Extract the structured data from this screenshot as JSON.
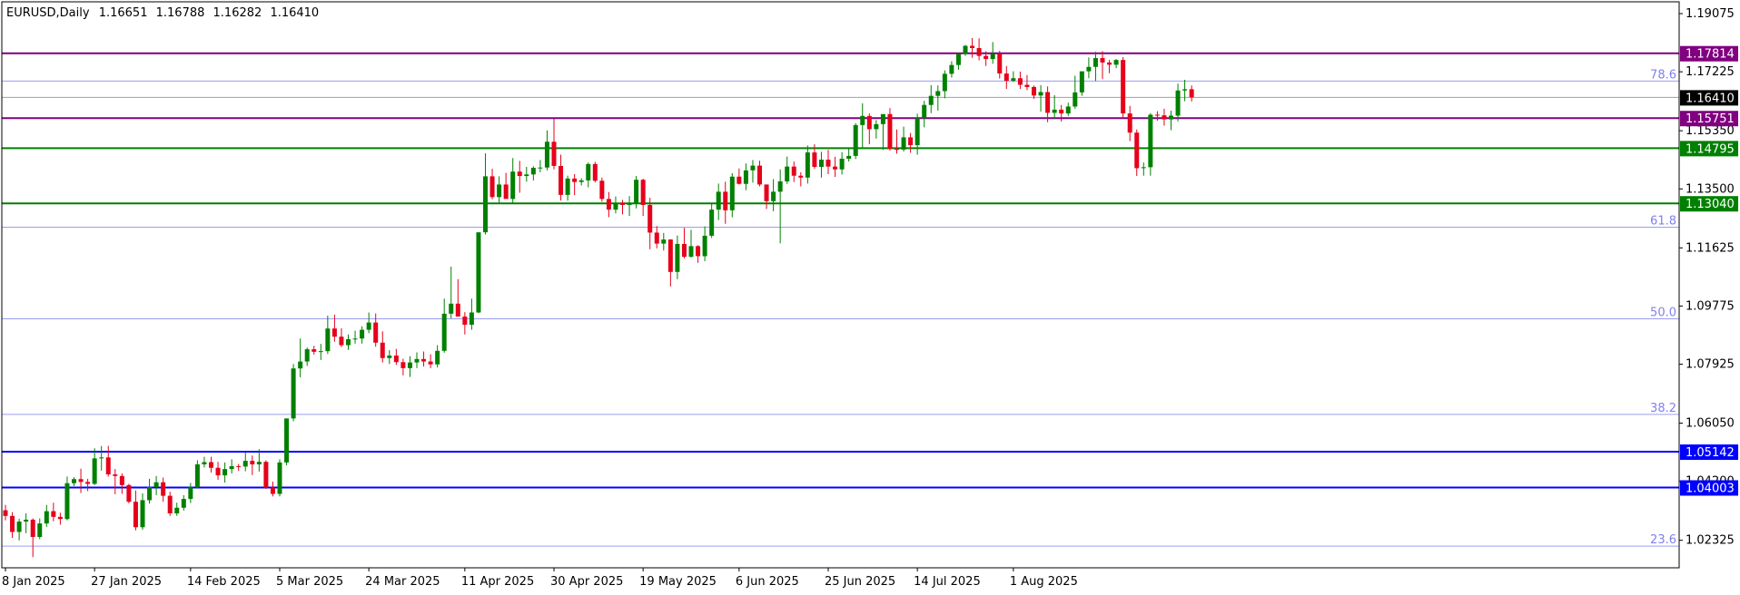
{
  "header": {
    "symbol": "EURUSD,Daily",
    "open": "1.16651",
    "high": "1.16788",
    "low": "1.16282",
    "close": "1.16410"
  },
  "colors": {
    "background": "#ffffff",
    "frame": "#000000",
    "bull": "#008000",
    "bear": "#e6001a",
    "fib": "#9c9cf2",
    "fib_text": "#8080ee",
    "resistance": "#800080",
    "support_mid": "#008000",
    "support_low": "#0000ff",
    "price_line": "#a0a0a0",
    "current_label_bg": "#000000"
  },
  "chart_data": {
    "type": "candlestick",
    "symbol": "EURUSD",
    "timeframe": "Daily",
    "ylim": [
      1.0145,
      1.1945
    ],
    "yticks": [
      "1.19075",
      "1.17225",
      "1.15350",
      "1.13500",
      "1.11625",
      "1.09775",
      "1.07925",
      "1.06050",
      "1.04200",
      "1.02325"
    ],
    "ytick_values": [
      1.19075,
      1.17225,
      1.1535,
      1.135,
      1.11625,
      1.09775,
      1.07925,
      1.0605,
      1.042,
      1.02325
    ],
    "xticks": [
      {
        "label": "8 Jan 2025",
        "index": 0
      },
      {
        "label": "27 Jan 2025",
        "index": 13
      },
      {
        "label": "14 Feb 2025",
        "index": 27
      },
      {
        "label": "5 Mar 2025",
        "index": 40
      },
      {
        "label": "24 Mar 2025",
        "index": 53
      },
      {
        "label": "11 Apr 2025",
        "index": 67
      },
      {
        "label": "30 Apr 2025",
        "index": 80
      },
      {
        "label": "19 May 2025",
        "index": 93
      },
      {
        "label": "6 Jun 2025",
        "index": 107
      },
      {
        "label": "25 Jun 2025",
        "index": 120
      },
      {
        "label": "14 Jul 2025",
        "index": 133
      },
      {
        "label": "1 Aug 2025",
        "index": 147
      }
    ],
    "horizontal_levels": [
      {
        "label": "1.17814",
        "value": 1.17814,
        "color": "#800080"
      },
      {
        "label": "1.15751",
        "value": 1.15751,
        "color": "#800080"
      },
      {
        "label": "1.14795",
        "value": 1.14795,
        "color": "#008000"
      },
      {
        "label": "1.13040",
        "value": 1.1304,
        "color": "#008000"
      },
      {
        "label": "1.05142",
        "value": 1.05142,
        "color": "#0000ff"
      },
      {
        "label": "1.04003",
        "value": 1.04003,
        "color": "#0000ff"
      }
    ],
    "current_price": {
      "label": "1.16410",
      "value": 1.1641
    },
    "fibonacci": [
      {
        "label": "78.6",
        "value": 1.1693
      },
      {
        "label": "61.8",
        "value": 1.1228
      },
      {
        "label": "50.0",
        "value": 1.0937
      },
      {
        "label": "38.2",
        "value": 1.0633
      },
      {
        "label": "23.6",
        "value": 1.0214
      }
    ],
    "candles": [
      [
        1.0328,
        1.0345,
        1.0296,
        1.031
      ],
      [
        1.031,
        1.0322,
        1.024,
        1.0259
      ],
      [
        1.0259,
        1.0301,
        1.0232,
        1.0292
      ],
      [
        1.0292,
        1.0318,
        1.0255,
        1.0298
      ],
      [
        1.0298,
        1.0302,
        1.0179,
        1.0243
      ],
      [
        1.0243,
        1.0302,
        1.0236,
        1.0286
      ],
      [
        1.0286,
        1.0345,
        1.0275,
        1.0325
      ],
      [
        1.0325,
        1.0352,
        1.0293,
        1.0307
      ],
      [
        1.0307,
        1.032,
        1.0282,
        1.03
      ],
      [
        1.03,
        1.0435,
        1.0296,
        1.0414
      ],
      [
        1.0414,
        1.0433,
        1.0405,
        1.0427
      ],
      [
        1.0427,
        1.046,
        1.0383,
        1.0418
      ],
      [
        1.0418,
        1.0428,
        1.0389,
        1.0412
      ],
      [
        1.0412,
        1.0525,
        1.0408,
        1.0493
      ],
      [
        1.0493,
        1.0532,
        1.0454,
        1.0496
      ],
      [
        1.0496,
        1.0533,
        1.0435,
        1.0442
      ],
      [
        1.0442,
        1.0459,
        1.0379,
        1.0437
      ],
      [
        1.0437,
        1.0445,
        1.038,
        1.0408
      ],
      [
        1.0408,
        1.0412,
        1.035,
        1.0355
      ],
      [
        1.0355,
        1.0391,
        1.0264,
        1.0274
      ],
      [
        1.0274,
        1.0382,
        1.0266,
        1.036
      ],
      [
        1.036,
        1.0428,
        1.0349,
        1.0402
      ],
      [
        1.0402,
        1.0437,
        1.0376,
        1.0417
      ],
      [
        1.0417,
        1.0432,
        1.0355,
        1.0374
      ],
      [
        1.0374,
        1.0387,
        1.031,
        1.0318
      ],
      [
        1.0318,
        1.0352,
        1.031,
        1.0336
      ],
      [
        1.0336,
        1.0376,
        1.0327,
        1.0364
      ],
      [
        1.0364,
        1.0415,
        1.0351,
        1.0401
      ],
      [
        1.0401,
        1.0487,
        1.0397,
        1.0474
      ],
      [
        1.0474,
        1.0498,
        1.0464,
        1.0481
      ],
      [
        1.0481,
        1.0498,
        1.0448,
        1.0463
      ],
      [
        1.0463,
        1.0482,
        1.0425,
        1.0439
      ],
      [
        1.0439,
        1.048,
        1.0416,
        1.0459
      ],
      [
        1.0459,
        1.049,
        1.0445,
        1.0468
      ],
      [
        1.0468,
        1.0475,
        1.0453,
        1.0467
      ],
      [
        1.0467,
        1.0513,
        1.0452,
        1.0485
      ],
      [
        1.0485,
        1.0502,
        1.044,
        1.0474
      ],
      [
        1.0474,
        1.0522,
        1.0451,
        1.0482
      ],
      [
        1.0482,
        1.0487,
        1.0396,
        1.04
      ],
      [
        1.04,
        1.0419,
        1.0372,
        1.038
      ],
      [
        1.038,
        1.049,
        1.0372,
        1.048
      ],
      [
        1.048,
        1.0591,
        1.0471,
        1.062
      ],
      [
        1.062,
        1.0793,
        1.0611,
        1.0779
      ],
      [
        1.0779,
        1.0874,
        1.0751,
        1.0801
      ],
      [
        1.0801,
        1.0846,
        1.0787,
        1.084
      ],
      [
        1.084,
        1.0851,
        1.0823,
        1.0832
      ],
      [
        1.0832,
        1.0857,
        1.0806,
        1.0834
      ],
      [
        1.0834,
        1.0947,
        1.0825,
        1.0906
      ],
      [
        1.0906,
        1.095,
        1.0864,
        1.088
      ],
      [
        1.088,
        1.0907,
        1.0847,
        1.0853
      ],
      [
        1.0853,
        1.0887,
        1.0838,
        1.0872
      ],
      [
        1.0872,
        1.0899,
        1.0858,
        1.0874
      ],
      [
        1.0874,
        1.0913,
        1.0858,
        1.0902
      ],
      [
        1.0902,
        1.0957,
        1.0891,
        1.0925
      ],
      [
        1.0925,
        1.0954,
        1.0848,
        1.0861
      ],
      [
        1.0861,
        1.0897,
        1.0798,
        1.0812
      ],
      [
        1.0812,
        1.0837,
        1.0793,
        1.082
      ],
      [
        1.082,
        1.0841,
        1.079,
        1.0799
      ],
      [
        1.0799,
        1.081,
        1.0757,
        1.078
      ],
      [
        1.078,
        1.0818,
        1.0752,
        1.0798
      ],
      [
        1.0798,
        1.083,
        1.078,
        1.0809
      ],
      [
        1.0809,
        1.0833,
        1.0785,
        1.0801
      ],
      [
        1.0801,
        1.0824,
        1.078,
        1.0792
      ],
      [
        1.0792,
        1.0853,
        1.0782,
        1.0835
      ],
      [
        1.0835,
        1.1001,
        1.0829,
        1.0953
      ],
      [
        1.0953,
        1.1103,
        1.0938,
        1.0985
      ],
      [
        1.0985,
        1.1063,
        1.0964,
        1.0944
      ],
      [
        1.0944,
        1.0958,
        1.0887,
        1.0918
      ],
      [
        1.0918,
        1.1001,
        1.0902,
        1.0957
      ],
      [
        1.0957,
        1.1144,
        1.0955,
        1.1212
      ],
      [
        1.1212,
        1.1463,
        1.1205,
        1.139
      ],
      [
        1.139,
        1.1414,
        1.1317,
        1.1324
      ],
      [
        1.1324,
        1.139,
        1.1306,
        1.1364
      ],
      [
        1.1364,
        1.1401,
        1.1327,
        1.1318
      ],
      [
        1.1318,
        1.1448,
        1.1302,
        1.1405
      ],
      [
        1.1405,
        1.1439,
        1.1338,
        1.1391
      ],
      [
        1.1391,
        1.142,
        1.1373,
        1.1396
      ],
      [
        1.1396,
        1.1422,
        1.1377,
        1.1417
      ],
      [
        1.1417,
        1.1442,
        1.1403,
        1.1418
      ],
      [
        1.1418,
        1.1536,
        1.1409,
        1.15
      ],
      [
        1.15,
        1.1573,
        1.1412,
        1.1423
      ],
      [
        1.1423,
        1.1459,
        1.1313,
        1.1331
      ],
      [
        1.1331,
        1.1392,
        1.1313,
        1.1383
      ],
      [
        1.1383,
        1.1397,
        1.133,
        1.1372
      ],
      [
        1.1372,
        1.1384,
        1.1361,
        1.1377
      ],
      [
        1.1377,
        1.1434,
        1.1355,
        1.1429
      ],
      [
        1.1429,
        1.1436,
        1.1371,
        1.1376
      ],
      [
        1.1376,
        1.1386,
        1.1309,
        1.1318
      ],
      [
        1.1318,
        1.134,
        1.126,
        1.1284
      ],
      [
        1.1284,
        1.1326,
        1.1272,
        1.1306
      ],
      [
        1.1306,
        1.1315,
        1.1269,
        1.1299
      ],
      [
        1.1299,
        1.1327,
        1.1264,
        1.1306
      ],
      [
        1.1306,
        1.1391,
        1.1288,
        1.1379
      ],
      [
        1.1379,
        1.1382,
        1.1264,
        1.1299
      ],
      [
        1.1299,
        1.1322,
        1.1158,
        1.1211
      ],
      [
        1.1211,
        1.1232,
        1.1161,
        1.1176
      ],
      [
        1.1176,
        1.121,
        1.1154,
        1.1189
      ],
      [
        1.1189,
        1.119,
        1.104,
        1.1086
      ],
      [
        1.1086,
        1.1202,
        1.1063,
        1.1175
      ],
      [
        1.1175,
        1.1226,
        1.1129,
        1.1134
      ],
      [
        1.1134,
        1.122,
        1.1132,
        1.1168
      ],
      [
        1.1168,
        1.1171,
        1.1115,
        1.1136
      ],
      [
        1.1136,
        1.1231,
        1.112,
        1.1201
      ],
      [
        1.1201,
        1.1302,
        1.1194,
        1.1284
      ],
      [
        1.1284,
        1.1367,
        1.1251,
        1.1341
      ],
      [
        1.1341,
        1.1373,
        1.1239,
        1.1282
      ],
      [
        1.1282,
        1.14,
        1.126,
        1.1389
      ],
      [
        1.1389,
        1.1415,
        1.1364,
        1.1366
      ],
      [
        1.1366,
        1.1431,
        1.1346,
        1.1409
      ],
      [
        1.1409,
        1.1442,
        1.137,
        1.1424
      ],
      [
        1.1424,
        1.144,
        1.1358,
        1.1364
      ],
      [
        1.1364,
        1.1364,
        1.1286,
        1.1311
      ],
      [
        1.1311,
        1.1381,
        1.1279,
        1.1341
      ],
      [
        1.1341,
        1.1412,
        1.1177,
        1.1374
      ],
      [
        1.1374,
        1.1453,
        1.1366,
        1.1421
      ],
      [
        1.1421,
        1.1437,
        1.1372,
        1.1392
      ],
      [
        1.1392,
        1.1403,
        1.1358,
        1.1386
      ],
      [
        1.1386,
        1.1488,
        1.1367,
        1.1466
      ],
      [
        1.1466,
        1.1492,
        1.1414,
        1.142
      ],
      [
        1.142,
        1.1468,
        1.1386,
        1.1443
      ],
      [
        1.1443,
        1.1474,
        1.1397,
        1.1421
      ],
      [
        1.1421,
        1.1452,
        1.1388,
        1.1412
      ],
      [
        1.1412,
        1.1467,
        1.1396,
        1.1446
      ],
      [
        1.1446,
        1.148,
        1.1437,
        1.1455
      ],
      [
        1.1455,
        1.1559,
        1.1445,
        1.1553
      ],
      [
        1.1553,
        1.1622,
        1.1481,
        1.1582
      ],
      [
        1.1582,
        1.159,
        1.1492,
        1.154
      ],
      [
        1.154,
        1.1569,
        1.151,
        1.1556
      ],
      [
        1.1556,
        1.1569,
        1.1474,
        1.1588
      ],
      [
        1.1588,
        1.1607,
        1.1472,
        1.1477
      ],
      [
        1.1477,
        1.1539,
        1.1462,
        1.1475
      ],
      [
        1.1475,
        1.1548,
        1.1469,
        1.1514
      ],
      [
        1.1514,
        1.1528,
        1.1465,
        1.1489
      ],
      [
        1.1489,
        1.1589,
        1.1459,
        1.1575
      ],
      [
        1.1575,
        1.163,
        1.1546,
        1.1617
      ],
      [
        1.1617,
        1.168,
        1.1591,
        1.1646
      ],
      [
        1.1646,
        1.1679,
        1.1599,
        1.1661
      ],
      [
        1.1661,
        1.1727,
        1.1638,
        1.1716
      ],
      [
        1.1716,
        1.1756,
        1.1704,
        1.1744
      ],
      [
        1.1744,
        1.1781,
        1.1729,
        1.1779
      ],
      [
        1.1779,
        1.1808,
        1.1773,
        1.1805
      ],
      [
        1.1805,
        1.183,
        1.1767,
        1.1798
      ],
      [
        1.1798,
        1.1829,
        1.1759,
        1.1773
      ],
      [
        1.1773,
        1.1788,
        1.1741,
        1.1763
      ],
      [
        1.1763,
        1.1817,
        1.1748,
        1.178
      ],
      [
        1.178,
        1.1789,
        1.1701,
        1.1717
      ],
      [
        1.1717,
        1.1741,
        1.1668,
        1.1694
      ],
      [
        1.1694,
        1.1724,
        1.169,
        1.1702
      ],
      [
        1.1702,
        1.1723,
        1.1668,
        1.1681
      ],
      [
        1.1681,
        1.1712,
        1.1664,
        1.1674
      ],
      [
        1.1674,
        1.1679,
        1.1636,
        1.1647
      ],
      [
        1.1647,
        1.168,
        1.1596,
        1.1658
      ],
      [
        1.1658,
        1.1676,
        1.1562,
        1.1592
      ],
      [
        1.1592,
        1.1648,
        1.1572,
        1.1602
      ],
      [
        1.1602,
        1.1617,
        1.1564,
        1.159
      ],
      [
        1.159,
        1.1624,
        1.1582,
        1.1612
      ],
      [
        1.1612,
        1.171,
        1.1605,
        1.1657
      ],
      [
        1.1657,
        1.1713,
        1.1646,
        1.1724
      ],
      [
        1.1724,
        1.1768,
        1.1702,
        1.1738
      ],
      [
        1.1738,
        1.1786,
        1.1693,
        1.1766
      ],
      [
        1.1766,
        1.1788,
        1.1699,
        1.1752
      ],
      [
        1.1752,
        1.176,
        1.1718,
        1.1745
      ],
      [
        1.1745,
        1.1763,
        1.1734,
        1.176
      ],
      [
        1.176,
        1.1769,
        1.1575,
        1.159
      ],
      [
        1.159,
        1.1614,
        1.1502,
        1.1529
      ],
      [
        1.1529,
        1.1539,
        1.1391,
        1.1416
      ],
      [
        1.1416,
        1.1434,
        1.1392,
        1.1419
      ],
      [
        1.1419,
        1.1591,
        1.1392,
        1.1586
      ],
      [
        1.1586,
        1.1597,
        1.1567,
        1.1584
      ],
      [
        1.1584,
        1.1605,
        1.1551,
        1.1571
      ],
      [
        1.1571,
        1.1599,
        1.1537,
        1.1583
      ],
      [
        1.1583,
        1.1685,
        1.1565,
        1.1663
      ],
      [
        1.1663,
        1.1697,
        1.1629,
        1.1667
      ],
      [
        1.1667,
        1.1679,
        1.1628,
        1.1641
      ]
    ]
  }
}
